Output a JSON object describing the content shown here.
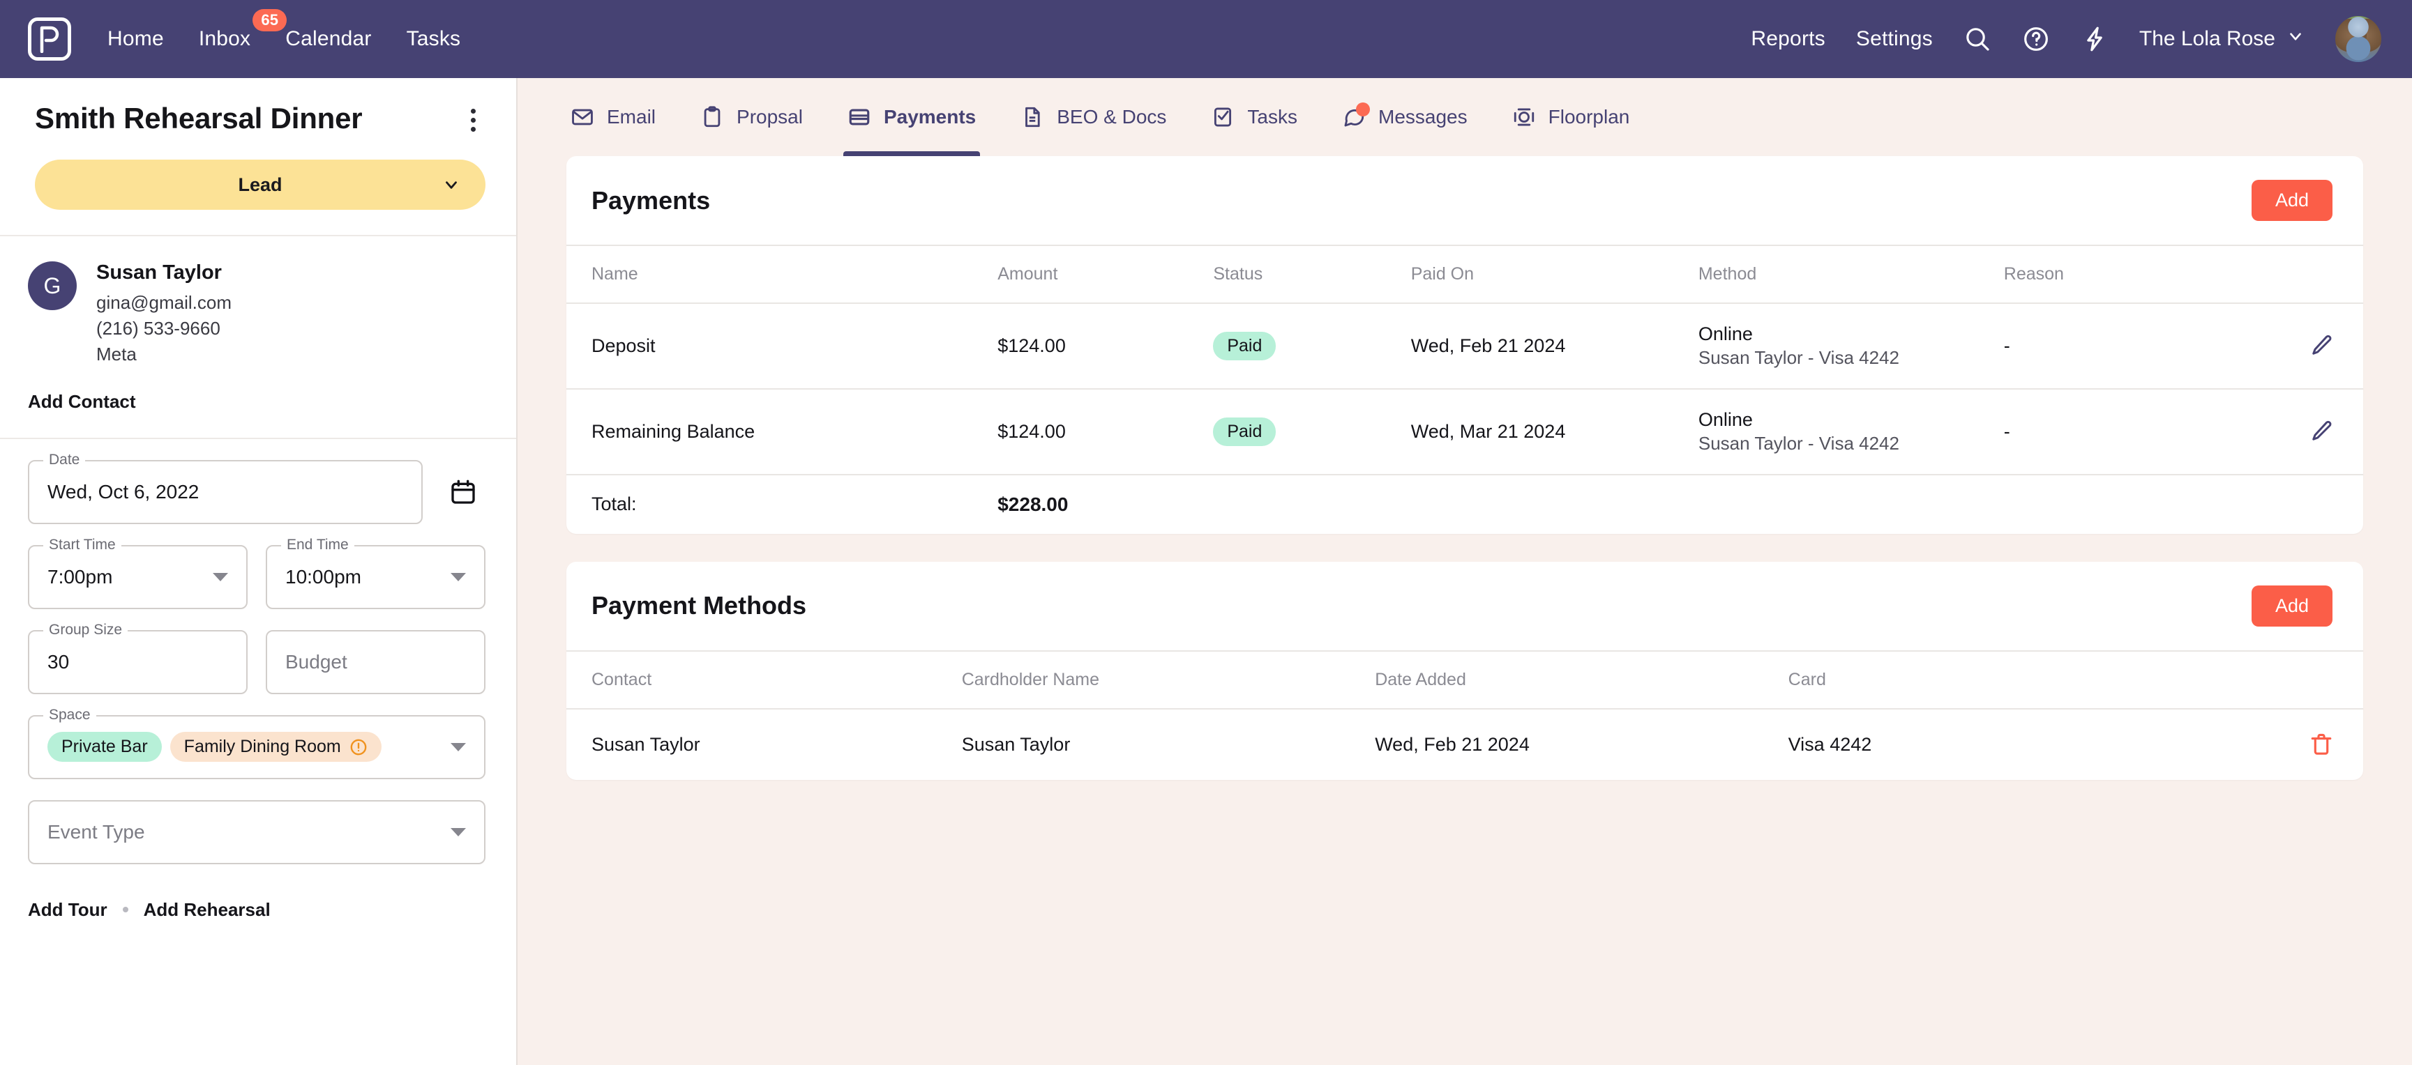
{
  "topnav": {
    "logo_icon": "pointer-p-logo-icon",
    "links": [
      {
        "label": "Home",
        "badge": null
      },
      {
        "label": "Inbox",
        "badge": "65"
      },
      {
        "label": "Calendar",
        "badge": null
      },
      {
        "label": "Tasks",
        "badge": null
      }
    ],
    "right_links": [
      {
        "label": "Reports"
      },
      {
        "label": "Settings"
      }
    ],
    "icons": [
      "search-icon",
      "help-circle-icon",
      "lightning-bolt-icon"
    ],
    "org_name": "The Lola Rose",
    "org_chevron": "chevron-down-icon",
    "avatar": "user-avatar"
  },
  "sidebar": {
    "event_title": "Smith Rehearsal Dinner",
    "menu_icon": "kebab-menu-icon",
    "status": "Lead",
    "status_chevron": "chevron-down-icon",
    "contact": {
      "initial": "G",
      "name": "Susan Taylor",
      "email": "gina@gmail.com",
      "phone": "(216) 533-9660",
      "company": "Meta"
    },
    "add_contact_label": "Add Contact",
    "fields": {
      "date": {
        "label": "Date",
        "value": "Wed, Oct 6, 2022"
      },
      "calendar_icon": "calendar-icon",
      "start_time": {
        "label": "Start Time",
        "value": "7:00pm"
      },
      "end_time": {
        "label": "End Time",
        "value": "10:00pm"
      },
      "group_size": {
        "label": "Group Size",
        "value": "30"
      },
      "budget": {
        "label": "Budget",
        "placeholder": "Budget",
        "value": ""
      },
      "space": {
        "label": "Space",
        "chips": [
          {
            "text": "Private Bar",
            "tone": "green",
            "icon": null
          },
          {
            "text": "Family Dining Room",
            "tone": "peach",
            "icon": "warning-circle-icon"
          }
        ]
      },
      "event_type": {
        "label": "Event Type",
        "placeholder": "Event Type",
        "value": ""
      }
    },
    "bottom_links": [
      "Add Tour",
      "Add Rehearsal"
    ]
  },
  "tabs": [
    {
      "label": "Email",
      "icon": "envelope-icon",
      "active": false,
      "dot": false
    },
    {
      "label": "Propsal",
      "icon": "clipboard-icon",
      "active": false,
      "dot": false
    },
    {
      "label": "Payments",
      "icon": "credit-card-icon",
      "active": true,
      "dot": false
    },
    {
      "label": "BEO & Docs",
      "icon": "document-icon",
      "active": false,
      "dot": false
    },
    {
      "label": "Tasks",
      "icon": "checklist-icon",
      "active": false,
      "dot": false
    },
    {
      "label": "Messages",
      "icon": "chat-bubble-icon",
      "active": false,
      "dot": true
    },
    {
      "label": "Floorplan",
      "icon": "floorplan-icon",
      "active": false,
      "dot": false
    }
  ],
  "payments_card": {
    "title": "Payments",
    "add_label": "Add",
    "columns": [
      "Name",
      "Amount",
      "Status",
      "Paid On",
      "Method",
      "Reason"
    ],
    "rows": [
      {
        "name": "Deposit",
        "amount": "$124.00",
        "status": "Paid",
        "paid_on": "Wed, Feb 21 2024",
        "method_main": "Online",
        "method_sub": "Susan Taylor - Visa 4242",
        "reason": "-",
        "action_icon": "edit-pencil-icon"
      },
      {
        "name": "Remaining Balance",
        "amount": "$124.00",
        "status": "Paid",
        "paid_on": "Wed, Mar 21 2024",
        "method_main": "Online",
        "method_sub": "Susan Taylor - Visa 4242",
        "reason": "-",
        "action_icon": "edit-pencil-icon"
      }
    ],
    "total_label": "Total:",
    "total_value": "$228.00"
  },
  "payment_methods_card": {
    "title": "Payment Methods",
    "add_label": "Add",
    "columns": [
      "Contact",
      "Cardholder Name",
      "Date Added",
      "Card"
    ],
    "rows": [
      {
        "contact": "Susan Taylor",
        "cardholder": "Susan Taylor",
        "date_added": "Wed, Feb 21 2024",
        "card": "Visa 4242",
        "action_icon": "trash-icon"
      }
    ]
  },
  "colors": {
    "nav_purple": "#464273",
    "accent_coral": "#FB5E48",
    "status_yellow": "#FCE296",
    "chip_green": "#B7F0D8",
    "chip_peach": "#FBE3CE",
    "page_bg": "#F9F0EC"
  }
}
